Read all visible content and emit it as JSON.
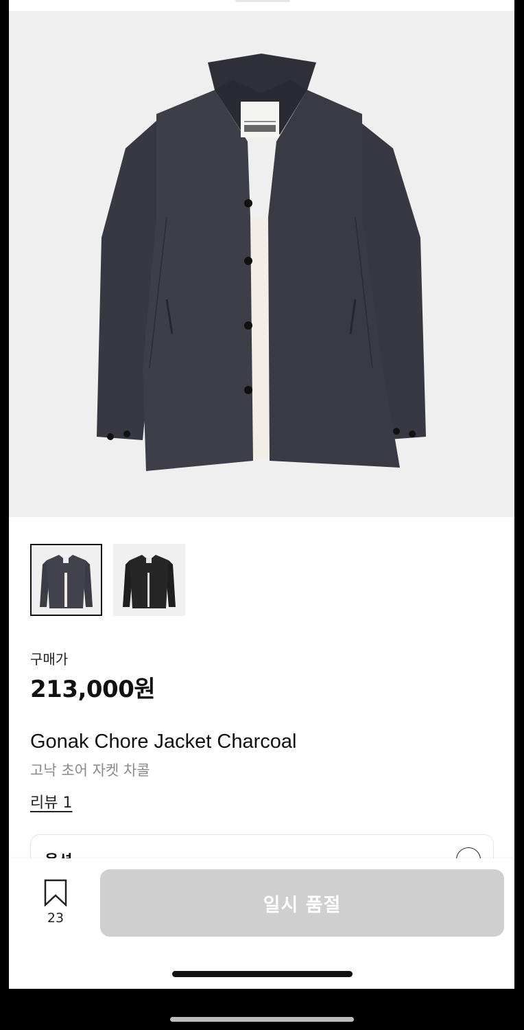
{
  "product": {
    "price_label": "구매가",
    "price": "213,000원",
    "name_en": "Gonak Chore Jacket Charcoal",
    "name_ko": "고낙 초어 자켓 차콜",
    "review_link": "리뷰 1",
    "option_label": "옵션",
    "thumbnails": [
      "charcoal",
      "black"
    ],
    "active_thumbnail_index": 0
  },
  "bottom_bar": {
    "bookmark_count": "23",
    "soldout_label": "일시 품절"
  },
  "colors": {
    "jacket_charcoal": "#3c3c44",
    "jacket_black": "#1e1e1e",
    "button_disabled": "#cfcfcf"
  }
}
